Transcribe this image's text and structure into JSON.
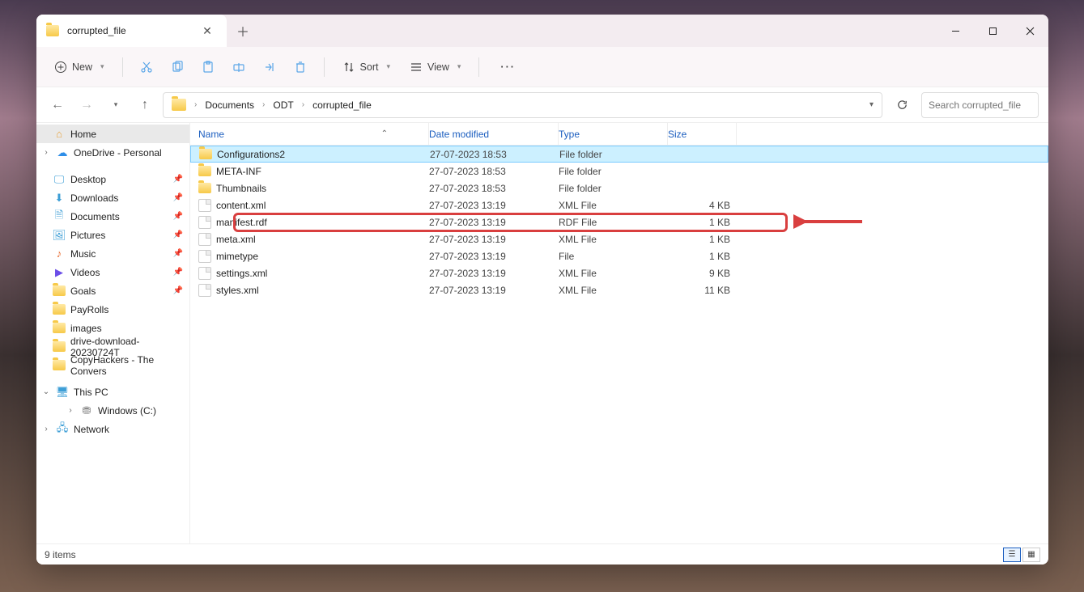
{
  "tab": {
    "title": "corrupted_file"
  },
  "toolbar": {
    "new": "New",
    "sort": "Sort",
    "view": "View"
  },
  "breadcrumb": [
    "Documents",
    "ODT",
    "corrupted_file"
  ],
  "search": {
    "placeholder": "Search corrupted_file"
  },
  "columns": {
    "name": "Name",
    "date": "Date modified",
    "type": "Type",
    "size": "Size"
  },
  "files": [
    {
      "name": "Configurations2",
      "date": "27-07-2023 18:53",
      "type": "File folder",
      "size": "",
      "icon": "folder",
      "selected": true
    },
    {
      "name": "META-INF",
      "date": "27-07-2023 18:53",
      "type": "File folder",
      "size": "",
      "icon": "folder"
    },
    {
      "name": "Thumbnails",
      "date": "27-07-2023 18:53",
      "type": "File folder",
      "size": "",
      "icon": "folder"
    },
    {
      "name": "content.xml",
      "date": "27-07-2023 13:19",
      "type": "XML File",
      "size": "4 KB",
      "icon": "file",
      "highlighted": true
    },
    {
      "name": "manifest.rdf",
      "date": "27-07-2023 13:19",
      "type": "RDF File",
      "size": "1 KB",
      "icon": "file"
    },
    {
      "name": "meta.xml",
      "date": "27-07-2023 13:19",
      "type": "XML File",
      "size": "1 KB",
      "icon": "file"
    },
    {
      "name": "mimetype",
      "date": "27-07-2023 13:19",
      "type": "File",
      "size": "1 KB",
      "icon": "file"
    },
    {
      "name": "settings.xml",
      "date": "27-07-2023 13:19",
      "type": "XML File",
      "size": "9 KB",
      "icon": "file"
    },
    {
      "name": "styles.xml",
      "date": "27-07-2023 13:19",
      "type": "XML File",
      "size": "11 KB",
      "icon": "file"
    }
  ],
  "sidebar": [
    {
      "label": "Home",
      "icon": "home",
      "selected": true,
      "level": 1
    },
    {
      "label": "OneDrive - Personal",
      "icon": "onedrive",
      "chev": ">",
      "level": 1
    },
    {
      "sep": true
    },
    {
      "label": "Desktop",
      "icon": "desktop",
      "pin": true,
      "level": 1
    },
    {
      "label": "Downloads",
      "icon": "downloads",
      "pin": true,
      "level": 1
    },
    {
      "label": "Documents",
      "icon": "documents",
      "pin": true,
      "level": 1
    },
    {
      "label": "Pictures",
      "icon": "pictures",
      "pin": true,
      "level": 1
    },
    {
      "label": "Music",
      "icon": "music",
      "pin": true,
      "level": 1
    },
    {
      "label": "Videos",
      "icon": "videos",
      "pin": true,
      "level": 1
    },
    {
      "label": "Goals",
      "icon": "folder",
      "pin": true,
      "level": 1
    },
    {
      "label": "PayRolls",
      "icon": "folder",
      "level": 1
    },
    {
      "label": "images",
      "icon": "folder",
      "level": 1
    },
    {
      "label": "drive-download-20230724T",
      "icon": "folder",
      "level": 1
    },
    {
      "label": "CopyHackers - The Convers",
      "icon": "folder",
      "level": 1
    },
    {
      "sep": true
    },
    {
      "label": "This PC",
      "icon": "thispc",
      "chev": "v",
      "level": 1
    },
    {
      "label": "Windows (C:)",
      "icon": "drive",
      "chev": ">",
      "level": 2
    },
    {
      "label": "Network",
      "icon": "network",
      "chev": ">",
      "level": 1
    }
  ],
  "status": {
    "items": "9 items"
  }
}
